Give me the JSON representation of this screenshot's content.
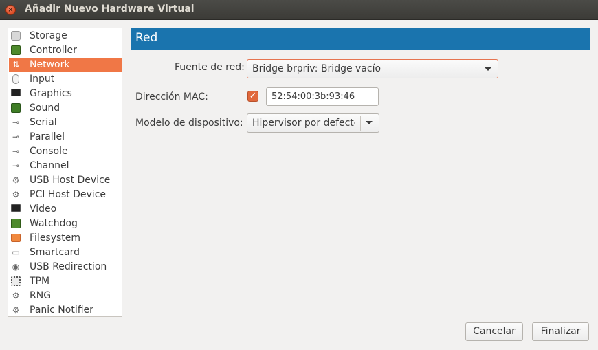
{
  "window": {
    "title": "Añadir Nuevo Hardware Virtual",
    "close_glyph": "×"
  },
  "sidebar": {
    "items": [
      {
        "label": "Storage",
        "icon": "storage-icon"
      },
      {
        "label": "Controller",
        "icon": "controller-icon"
      },
      {
        "label": "Network",
        "icon": "network-icon",
        "selected": true
      },
      {
        "label": "Input",
        "icon": "mouse-icon"
      },
      {
        "label": "Graphics",
        "icon": "monitor-icon"
      },
      {
        "label": "Sound",
        "icon": "sound-card-icon"
      },
      {
        "label": "Serial",
        "icon": "serial-plug-icon"
      },
      {
        "label": "Parallel",
        "icon": "parallel-plug-icon"
      },
      {
        "label": "Console",
        "icon": "console-plug-icon"
      },
      {
        "label": "Channel",
        "icon": "channel-plug-icon"
      },
      {
        "label": "USB Host Device",
        "icon": "usb-device-icon"
      },
      {
        "label": "PCI Host Device",
        "icon": "pci-device-icon"
      },
      {
        "label": "Video",
        "icon": "video-monitor-icon"
      },
      {
        "label": "Watchdog",
        "icon": "watchdog-icon"
      },
      {
        "label": "Filesystem",
        "icon": "folder-icon"
      },
      {
        "label": "Smartcard",
        "icon": "smartcard-icon"
      },
      {
        "label": "USB Redirection",
        "icon": "usb-redirection-icon"
      },
      {
        "label": "TPM",
        "icon": "chip-icon"
      },
      {
        "label": "RNG",
        "icon": "rng-icon"
      },
      {
        "label": "Panic Notifier",
        "icon": "panic-notifier-icon"
      }
    ]
  },
  "main": {
    "header_title": "Red",
    "network_source": {
      "label": "Fuente de red:",
      "value": "Bridge brpriv: Bridge vacío"
    },
    "mac": {
      "label": "Dirección MAC:",
      "checked": true,
      "value": "52:54:00:3b:93:46"
    },
    "device_model": {
      "label": "Modelo de dispositivo:",
      "value": "Hipervisor por defecto"
    }
  },
  "buttons": {
    "cancel": "Cancelar",
    "finish": "Finalizar"
  },
  "colors": {
    "accent": "#f07746",
    "header": "#1a74ae",
    "checkbox": "#e0683c"
  }
}
